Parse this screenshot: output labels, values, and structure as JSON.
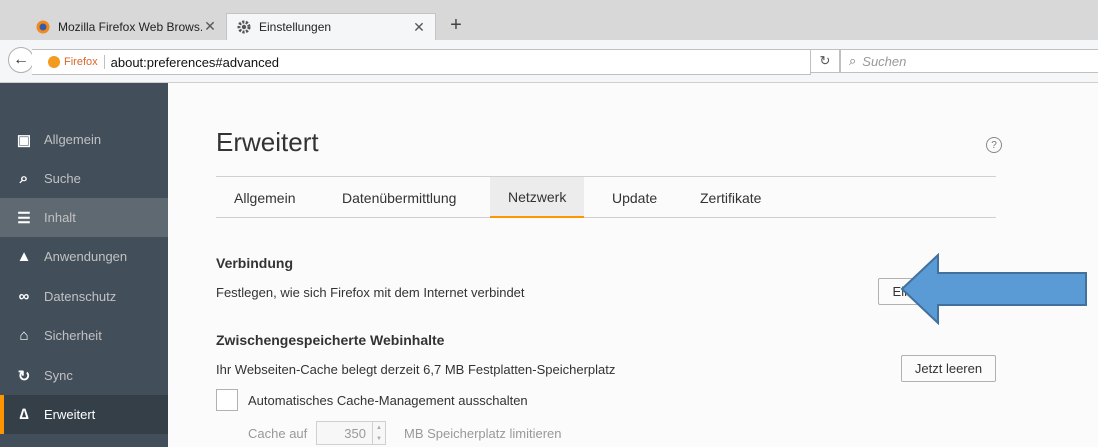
{
  "browser": {
    "tabs": [
      {
        "title": "Mozilla Firefox Web Brows...",
        "icon": "firefox-icon"
      },
      {
        "title": "Einstellungen",
        "icon": "gear-icon"
      }
    ],
    "close_glyph": "✕",
    "new_tab_glyph": "+",
    "identity_label": "Firefox",
    "url": "about:preferences#advanced",
    "search_placeholder": "Suchen"
  },
  "sidebar": {
    "items": [
      {
        "label": "Allgemein",
        "icon": "general-icon"
      },
      {
        "label": "Suche",
        "icon": "search-icon"
      },
      {
        "label": "Inhalt",
        "icon": "content-icon"
      },
      {
        "label": "Anwendungen",
        "icon": "applications-icon"
      },
      {
        "label": "Datenschutz",
        "icon": "privacy-mask-icon"
      },
      {
        "label": "Sicherheit",
        "icon": "lock-icon"
      },
      {
        "label": "Sync",
        "icon": "sync-icon"
      },
      {
        "label": "Erweitert",
        "icon": "advanced-wizard-icon"
      }
    ],
    "hovered_index": 2,
    "selected_index": 7
  },
  "main": {
    "title": "Erweitert",
    "help_glyph": "?",
    "tabs": [
      "Allgemein",
      "Datenübermittlung",
      "Netzwerk",
      "Update",
      "Zertifikate"
    ],
    "active_tab": "Netzwerk",
    "connection": {
      "heading": "Verbindung",
      "description": "Festlegen, wie sich Firefox mit dem Internet verbindet",
      "button": "Einstellungen..."
    },
    "cache": {
      "heading": "Zwischengespeicherte Webinhalte",
      "description": "Ihr Webseiten-Cache belegt derzeit 6,7 MB Festplatten-Speicherplatz",
      "button": "Jetzt leeren",
      "checkbox_label": "Automatisches Cache-Management ausschalten",
      "checkbox_checked": false,
      "limit_label": "Cache auf",
      "limit_value": "350",
      "limit_unit": "MB Speicherplatz limitieren"
    }
  },
  "annotation": {
    "arrow_color": "#5b9bd5",
    "arrow_outline": "#41719c"
  },
  "colors": {
    "sidebar_bg": "#424f5a",
    "accent": "#ff9500"
  }
}
